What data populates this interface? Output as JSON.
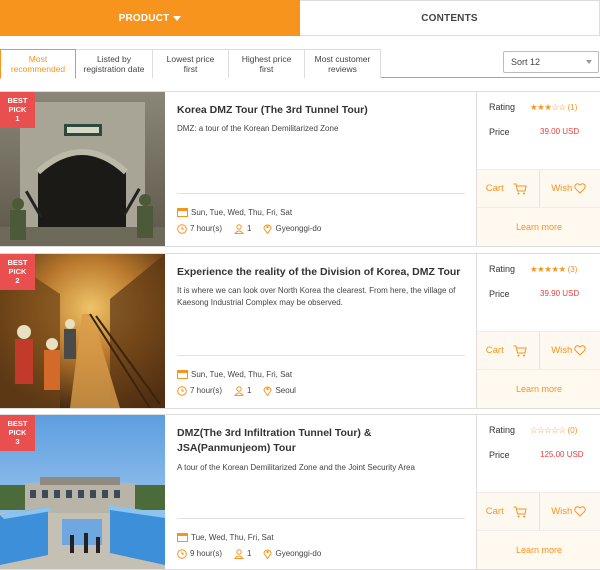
{
  "tabs": {
    "product": "PRODUCT",
    "contents": "CONTENTS"
  },
  "sort": {
    "options": [
      {
        "line1": "Most",
        "line2": "recommended"
      },
      {
        "line1": "Listed by",
        "line2": "registration date"
      },
      {
        "line1": "Lowest price",
        "line2": "first"
      },
      {
        "line1": "Highest price",
        "line2": "first"
      },
      {
        "line1": "Most customer",
        "line2": "reviews"
      }
    ],
    "select_value": "Sort 12"
  },
  "labels": {
    "rating": "Rating",
    "price": "Price",
    "cart": "Cart",
    "wish": "Wish",
    "learn_more": "Learn more",
    "badge_line1": "BEST",
    "badge_line2": "PICK"
  },
  "products": [
    {
      "rank": "1",
      "title": "Korea DMZ Tour (The 3rd Tunnel Tour)",
      "description": "DMZ: a tour of the Korean Demilitarized Zone",
      "days": "Sun, Tue, Wed, Thu, Fri, Sat",
      "duration": "7 hour(s)",
      "persons": "1",
      "location": "Gyeonggi-do",
      "stars": "★★★☆☆",
      "reviews": "(1)",
      "price": "39.00 USD"
    },
    {
      "rank": "2",
      "title": "Experience the reality of the Division of Korea, DMZ Tour",
      "description": "It is where we can look over North Korea the clearest. From here, the village of Kaesong Industrial Complex may be observed.",
      "days": "Sun, Tue, Wed, Thu, Fri, Sat",
      "duration": "7 hour(s)",
      "persons": "1",
      "location": "Seoul",
      "stars": "★★★★★",
      "reviews": "(3)",
      "price": "39.90 USD"
    },
    {
      "rank": "3",
      "title": "DMZ(The 3rd Infiltration Tunnel Tour) & JSA(Panmunjeom) Tour",
      "description": "A tour of the Korean Demilitarized Zone and the Joint Security Area",
      "days": "Tue, Wed, Thu, Fri, Sat",
      "duration": "9 hour(s)",
      "persons": "1",
      "location": "Gyeonggi-do",
      "stars": "☆☆☆☆☆",
      "reviews": "(0)",
      "price": "125.00 USD"
    }
  ],
  "colors": {
    "accent": "#f7941d",
    "badge": "#e94f4f",
    "price": "#e94040"
  }
}
